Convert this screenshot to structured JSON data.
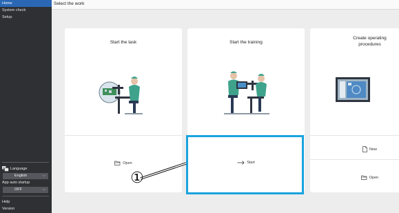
{
  "sidebar": {
    "items": [
      {
        "label": "Home",
        "active": true
      },
      {
        "label": "System check",
        "active": false
      },
      {
        "label": "Setup",
        "active": false
      }
    ],
    "language_label": "Language",
    "language_value": "English",
    "auto_startup_label": "App auto startup",
    "auto_startup_value": "OFF",
    "help_label": "Help",
    "version_label": "Version"
  },
  "header": {
    "title": "Select the work"
  },
  "cards": [
    {
      "title": "Start the task",
      "action_label": "Open",
      "action_icon": "folder-icon"
    },
    {
      "title": "Start the training",
      "action_label": "Start",
      "action_icon": "arrow-right-icon"
    },
    {
      "title": "Create operating procedures",
      "new_label": "New",
      "new_icon": "file-icon",
      "open_label": "Open",
      "open_icon": "folder-icon"
    }
  ],
  "callout": {
    "number": "①",
    "color": "#1aa3de"
  },
  "colors": {
    "sidebar": "#2f3033",
    "active": "#2a68b5",
    "highlight": "#1aa3de",
    "background": "#ededed"
  }
}
